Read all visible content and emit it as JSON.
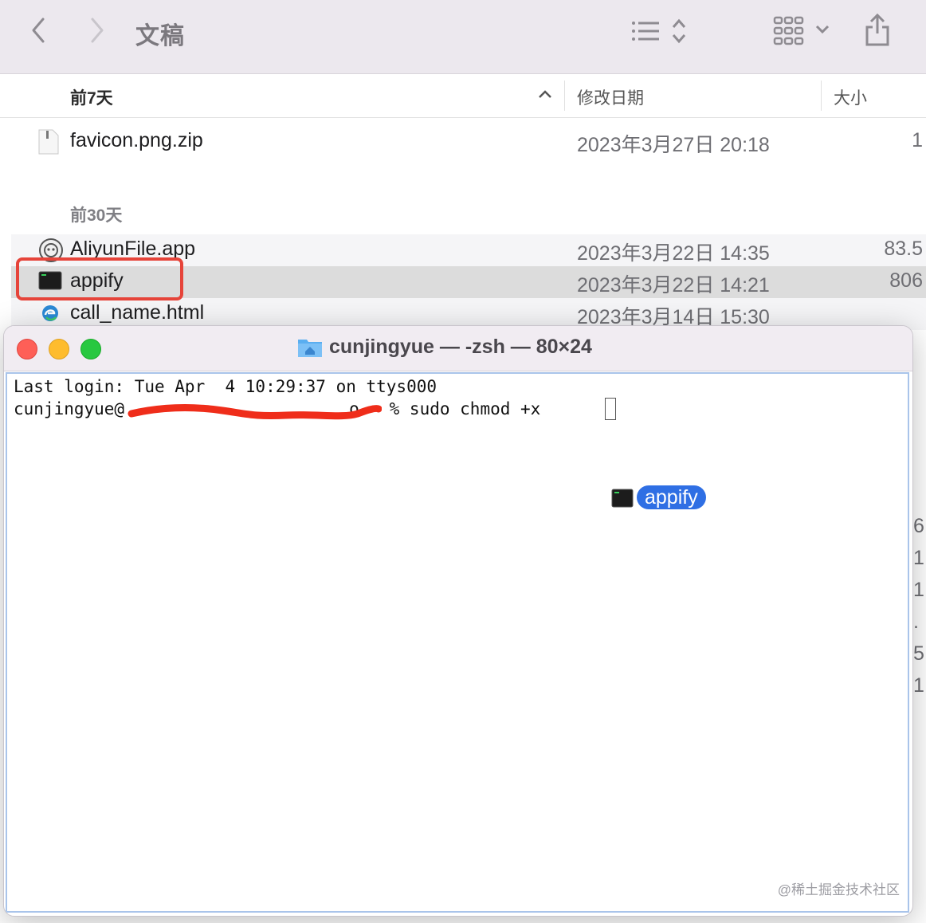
{
  "toolbar": {
    "folder_title": "文稿"
  },
  "columns": {
    "name": "前7天",
    "date": "修改日期",
    "size": "大小"
  },
  "groups": {
    "week_label": "前7天",
    "month_label": "前30天"
  },
  "files": [
    {
      "name": "favicon.png.zip",
      "date": "2023年3月27日 20:18",
      "size": "1",
      "icon": "zip-file-icon"
    },
    {
      "name": "AliyunFile.app",
      "date": "2023年3月22日 14:35",
      "size": "83.5",
      "icon": "aliyun-app-icon"
    },
    {
      "name": "appify",
      "date": "2023年3月22日 14:21",
      "size": "806",
      "icon": "terminal-exec-icon"
    },
    {
      "name": "call_name.html",
      "date": "2023年3月14日 15:30",
      "size": "",
      "icon": "edge-html-icon"
    }
  ],
  "edge_digits": [
    "6",
    "1",
    "1",
    ".",
    "5",
    "1"
  ],
  "terminal": {
    "title": "cunjingyue — -zsh — 80×24",
    "line1": "Last login: Tue Apr  4 10:29:37 on ttys000",
    "line2_prefix": "cunjingyue@",
    "line2_suffix": "o ~ % sudo chmod +x ",
    "drag_label": "appify"
  },
  "watermark": "@稀土掘金技术社区",
  "colors": {
    "highlight": "#e6443a",
    "drag_accent": "#2f6fe4",
    "selection": "#dcdcdc"
  }
}
